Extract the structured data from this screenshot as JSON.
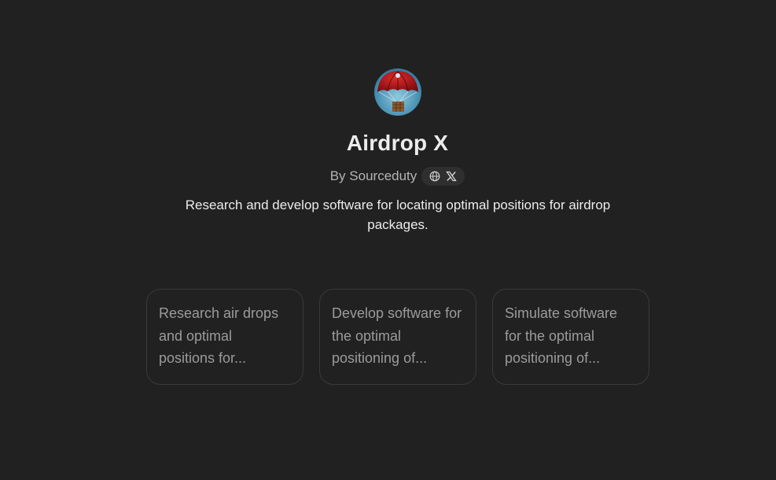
{
  "gpt": {
    "name": "Airdrop X",
    "byline": "By Sourceduty",
    "description": "Research and develop software for locating optimal positions for airdrop packages."
  },
  "social": {
    "icons": [
      "globe-icon",
      "x-logo-icon"
    ]
  },
  "conversation_starters": [
    {
      "text": "Research air drops and optimal positions for..."
    },
    {
      "text": "Develop software for the optimal positioning of..."
    },
    {
      "text": "Simulate software for the optimal positioning of..."
    }
  ],
  "colors": {
    "background": "#212121",
    "card_border": "#3a3a3a",
    "pill_background": "#2f2f2f",
    "primary_text": "#ececec",
    "muted_text": "#9b9b9b"
  }
}
